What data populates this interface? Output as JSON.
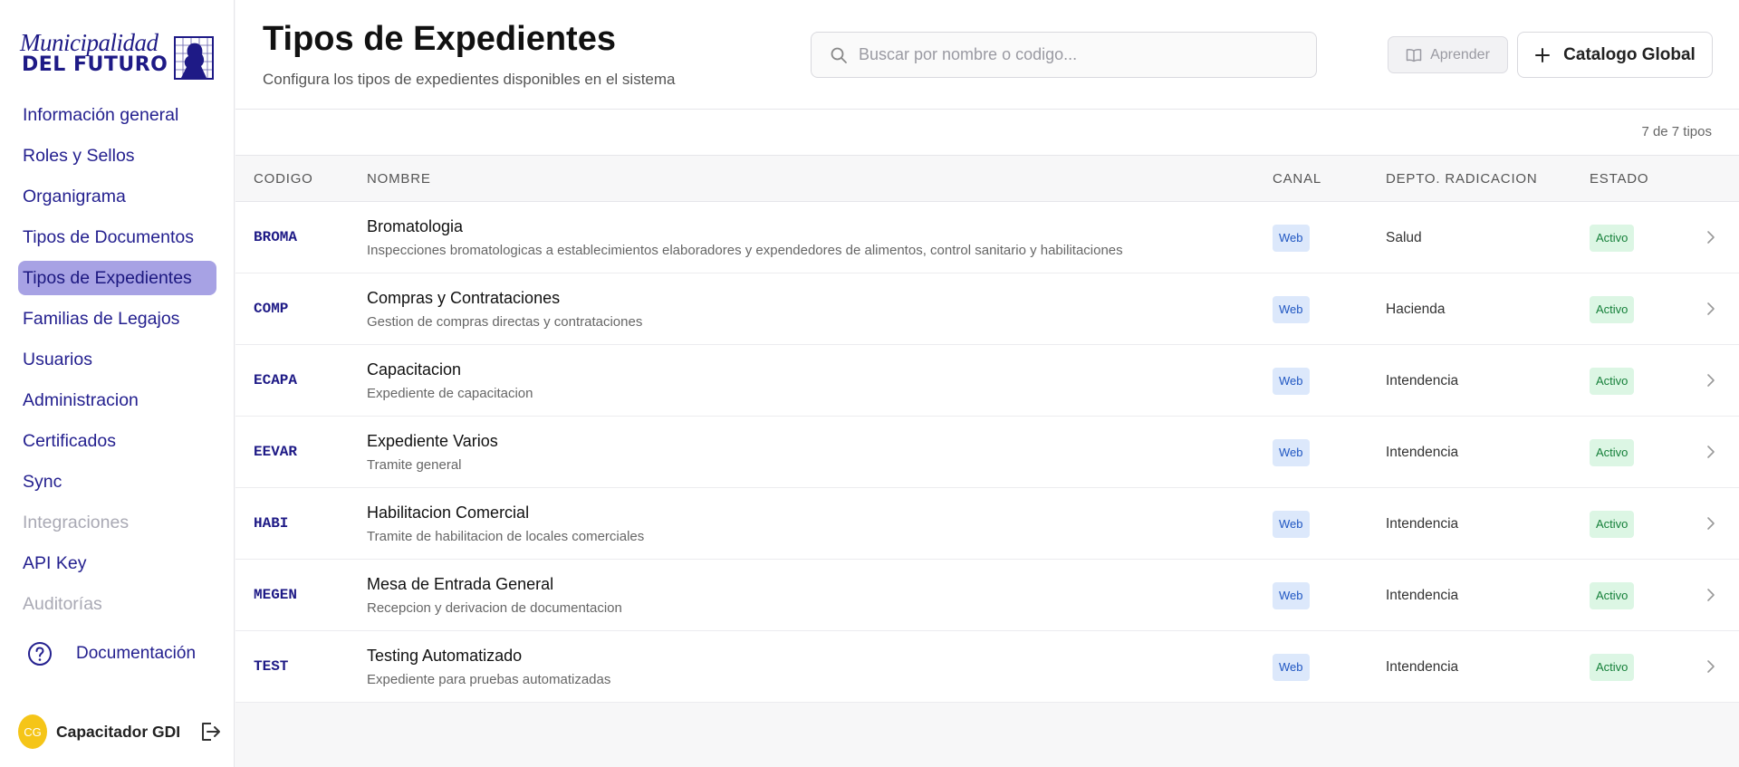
{
  "sidebar": {
    "logo": {
      "script": "Municipalidad",
      "bold": "DEL FUTURO"
    },
    "items": [
      {
        "label": "Información general",
        "state": "normal"
      },
      {
        "label": "Roles y Sellos",
        "state": "normal"
      },
      {
        "label": "Organigrama",
        "state": "normal"
      },
      {
        "label": "Tipos de Documentos",
        "state": "normal"
      },
      {
        "label": "Tipos de Expedientes",
        "state": "active"
      },
      {
        "label": "Familias de Legajos",
        "state": "normal"
      },
      {
        "label": "Usuarios",
        "state": "normal"
      },
      {
        "label": "Administracion",
        "state": "normal"
      },
      {
        "label": "Certificados",
        "state": "normal"
      },
      {
        "label": "Sync",
        "state": "normal"
      },
      {
        "label": "Integraciones",
        "state": "disabled"
      },
      {
        "label": "API Key",
        "state": "normal"
      },
      {
        "label": "Auditorías",
        "state": "disabled"
      }
    ],
    "docs_label": "Documentación",
    "docs_icon": "help-circle-icon",
    "user": {
      "initials": "CG",
      "name": "Capacitador GDI",
      "logout_icon": "logout-icon"
    }
  },
  "header": {
    "title": "Tipos de Expedientes",
    "subtitle": "Configura los tipos de expedientes disponibles en el sistema",
    "search_placeholder": "Buscar por nombre o codigo...",
    "learn_label": "Aprender",
    "catalog_label": "Catalogo Global"
  },
  "count_label": "7 de 7 tipos",
  "table": {
    "columns": {
      "codigo": "CODIGO",
      "nombre": "NOMBRE",
      "canal": "CANAL",
      "depto": "DEPTO. RADICACION",
      "estado": "ESTADO"
    },
    "rows": [
      {
        "code": "BROMA",
        "name": "Bromatologia",
        "desc": "Inspecciones bromatologicas a establecimientos elaboradores y expendedores de alimentos, control sanitario y habilitaciones",
        "canal": "Web",
        "depto": "Salud",
        "estado": "Activo"
      },
      {
        "code": "COMP",
        "name": "Compras y Contrataciones",
        "desc": "Gestion de compras directas y contrataciones",
        "canal": "Web",
        "depto": "Hacienda",
        "estado": "Activo"
      },
      {
        "code": "ECAPA",
        "name": "Capacitacion",
        "desc": "Expediente de capacitacion",
        "canal": "Web",
        "depto": "Intendencia",
        "estado": "Activo"
      },
      {
        "code": "EEVAR",
        "name": "Expediente Varios",
        "desc": "Tramite general",
        "canal": "Web",
        "depto": "Intendencia",
        "estado": "Activo"
      },
      {
        "code": "HABI",
        "name": "Habilitacion Comercial",
        "desc": "Tramite de habilitacion de locales comerciales",
        "canal": "Web",
        "depto": "Intendencia",
        "estado": "Activo"
      },
      {
        "code": "MEGEN",
        "name": "Mesa de Entrada General",
        "desc": "Recepcion y derivacion de documentacion",
        "canal": "Web",
        "depto": "Intendencia",
        "estado": "Activo"
      },
      {
        "code": "TEST",
        "name": "Testing Automatizado",
        "desc": "Expediente para pruebas automatizadas",
        "canal": "Web",
        "depto": "Intendencia",
        "estado": "Activo"
      }
    ]
  },
  "colors": {
    "brand": "#1e1a86",
    "active_nav_bg": "#a7a2e4",
    "canal_bg": "#dce8fb",
    "canal_text": "#1f56c2",
    "estado_bg": "#dcf6e4",
    "estado_text": "#16803a",
    "avatar": "#f5c518"
  }
}
